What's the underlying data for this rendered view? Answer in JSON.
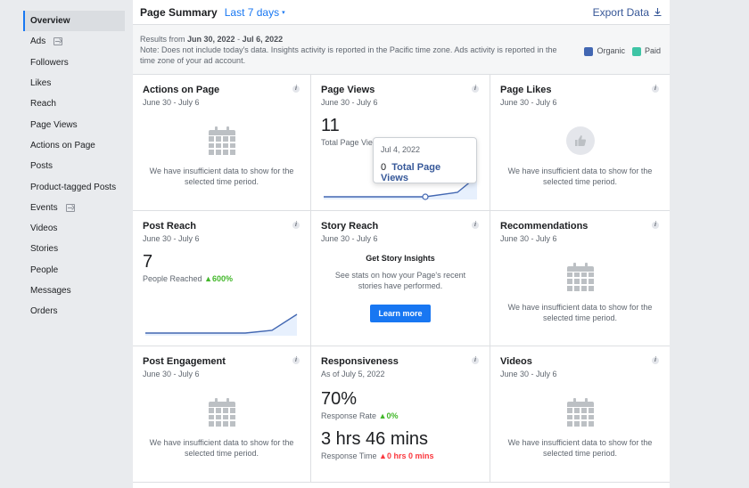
{
  "sidebar": {
    "items": [
      {
        "label": "Overview",
        "active": true
      },
      {
        "label": "Ads",
        "ext": true
      },
      {
        "label": "Followers"
      },
      {
        "label": "Likes"
      },
      {
        "label": "Reach"
      },
      {
        "label": "Page Views"
      },
      {
        "label": "Actions on Page"
      },
      {
        "label": "Posts"
      },
      {
        "label": "Product-tagged Posts"
      },
      {
        "label": "Events",
        "ext": true
      },
      {
        "label": "Videos"
      },
      {
        "label": "Stories"
      },
      {
        "label": "People"
      },
      {
        "label": "Messages"
      },
      {
        "label": "Orders"
      }
    ]
  },
  "header": {
    "title": "Page Summary",
    "range": "Last 7 days",
    "export": "Export Data"
  },
  "notice": {
    "results_prefix": "Results from ",
    "start": "Jun 30, 2022",
    "separator": " - ",
    "end": "Jul 6, 2022",
    "note": "Note: Does not include today's data. Insights activity is reported in the Pacific time zone. Ads activity is reported in the time zone of your ad account."
  },
  "legend": {
    "organic": "Organic",
    "paid": "Paid",
    "organic_color": "#4267b2",
    "paid_color": "#3ec4a5"
  },
  "empty_msg": "We have insufficient data to show for the selected time period.",
  "cards": {
    "actions": {
      "title": "Actions on Page",
      "date": "June 30 - July 6"
    },
    "page_views": {
      "title": "Page Views",
      "date": "June 30 - July 6",
      "value": "11",
      "label": "Total Page Vie"
    },
    "page_likes": {
      "title": "Page Likes",
      "date": "June 30 - July 6"
    },
    "post_reach": {
      "title": "Post Reach",
      "date": "June 30 - July 6",
      "value": "7",
      "label": "People Reached",
      "change": "600%"
    },
    "story_reach": {
      "title": "Story Reach",
      "date": "June 30 - July 6",
      "cta_title": "Get Story Insights",
      "cta_desc": "See stats on how your Page's recent stories have performed.",
      "cta_button": "Learn more"
    },
    "recommendations": {
      "title": "Recommendations",
      "date": "June 30 - July 6"
    },
    "post_engagement": {
      "title": "Post Engagement",
      "date": "June 30 - July 6"
    },
    "responsiveness": {
      "title": "Responsiveness",
      "date": "As of July 5, 2022",
      "rate": "70%",
      "rate_label": "Response Rate",
      "rate_change": "0%",
      "time": "3 hrs 46 mins",
      "time_label": "Response Time",
      "time_change": "0 hrs 0 mins"
    },
    "videos": {
      "title": "Videos",
      "date": "June 30 - July 6"
    }
  },
  "tooltip": {
    "date": "Jul 4, 2022",
    "value": "0",
    "label": "Total Page Views"
  }
}
